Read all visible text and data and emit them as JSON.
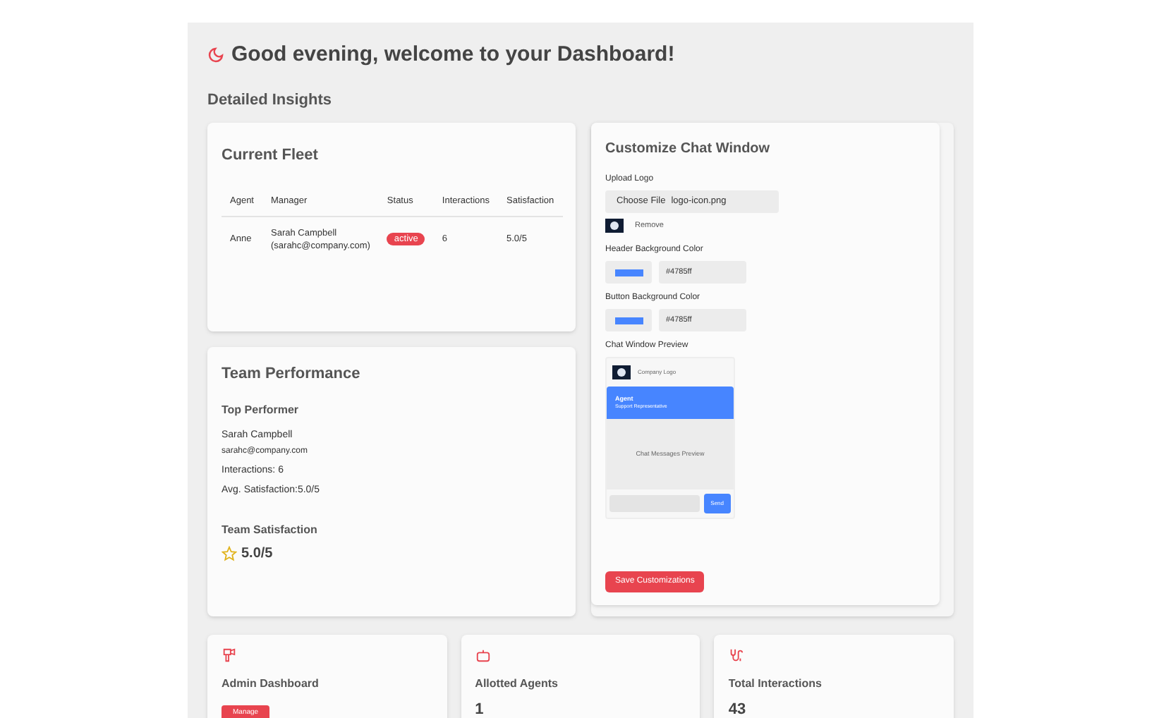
{
  "greeting": "Good evening, welcome to your Dashboard!",
  "section_title": "Detailed Insights",
  "fleet": {
    "title": "Current Fleet",
    "columns": [
      "Agent",
      "Manager",
      "Status",
      "Interactions",
      "Satisfaction"
    ],
    "rows": [
      {
        "agent": "Anne",
        "manager_name": "Sarah Campbell",
        "manager_email": "(sarahc@company.com)",
        "status": "active",
        "interactions": "6",
        "satisfaction": "5.0/5"
      }
    ]
  },
  "team_performance": {
    "title": "Team Performance",
    "top_performer_label": "Top Performer",
    "name": "Sarah Campbell",
    "email": "sarahc@company.com",
    "interactions": "Interactions: 6",
    "avg_satisfaction": "Avg. Satisfaction:5.0/5",
    "team_satisfaction_label": "Team Satisfaction",
    "team_satisfaction": "5.0/5"
  },
  "customize": {
    "title": "Customize Chat Window",
    "upload_label": "Upload Logo",
    "choose_file": "Choose File",
    "file_name": "logo-icon.png",
    "remove": "Remove",
    "header_color_label": "Header Background Color",
    "header_color": "#4785ff",
    "button_color_label": "Button Background Color",
    "button_color": "#4785ff",
    "preview_label": "Chat Window Preview",
    "preview": {
      "logo_text": "Company Logo",
      "agent": "Agent",
      "role": "Support Representative",
      "messages": "Chat Messages Preview",
      "send": "Send"
    },
    "save": "Save Customizations"
  },
  "stat_cards": [
    {
      "kind": "action",
      "title": "Admin Dashboard",
      "button": "Manage"
    },
    {
      "kind": "value",
      "title": "Allotted Agents",
      "value": "1"
    },
    {
      "kind": "value",
      "title": "Total Interactions",
      "value": "43"
    }
  ]
}
